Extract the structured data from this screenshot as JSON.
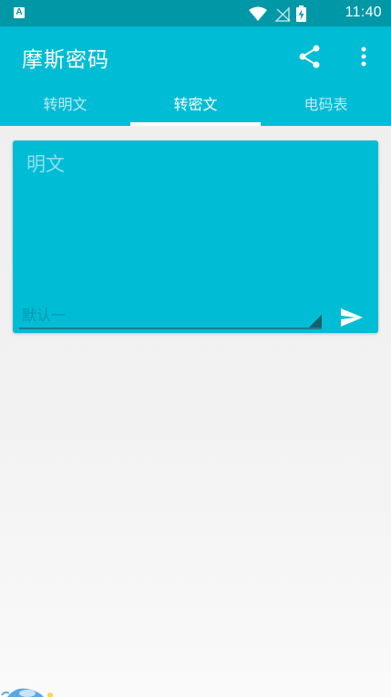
{
  "status_bar": {
    "notification_icon": "app-store-icon",
    "notification_glyph": "A",
    "icons": [
      "wifi-icon",
      "no-signal-icon",
      "battery-charging-icon"
    ],
    "time": "11:40"
  },
  "app_bar": {
    "title": "摩斯密码",
    "actions": [
      "share-icon",
      "more-vert-icon"
    ]
  },
  "tabs": [
    {
      "label": "转明文",
      "active": false
    },
    {
      "label": "转密文",
      "active": true
    },
    {
      "label": "电码表",
      "active": false
    }
  ],
  "card": {
    "text": "明文",
    "input_hint": "默认一",
    "send_icon": "send-icon"
  },
  "colors": {
    "primary": "#00bcd4",
    "primary_dark": "#0097a7",
    "background": "#eeeeee",
    "indicator": "#ffffff"
  }
}
